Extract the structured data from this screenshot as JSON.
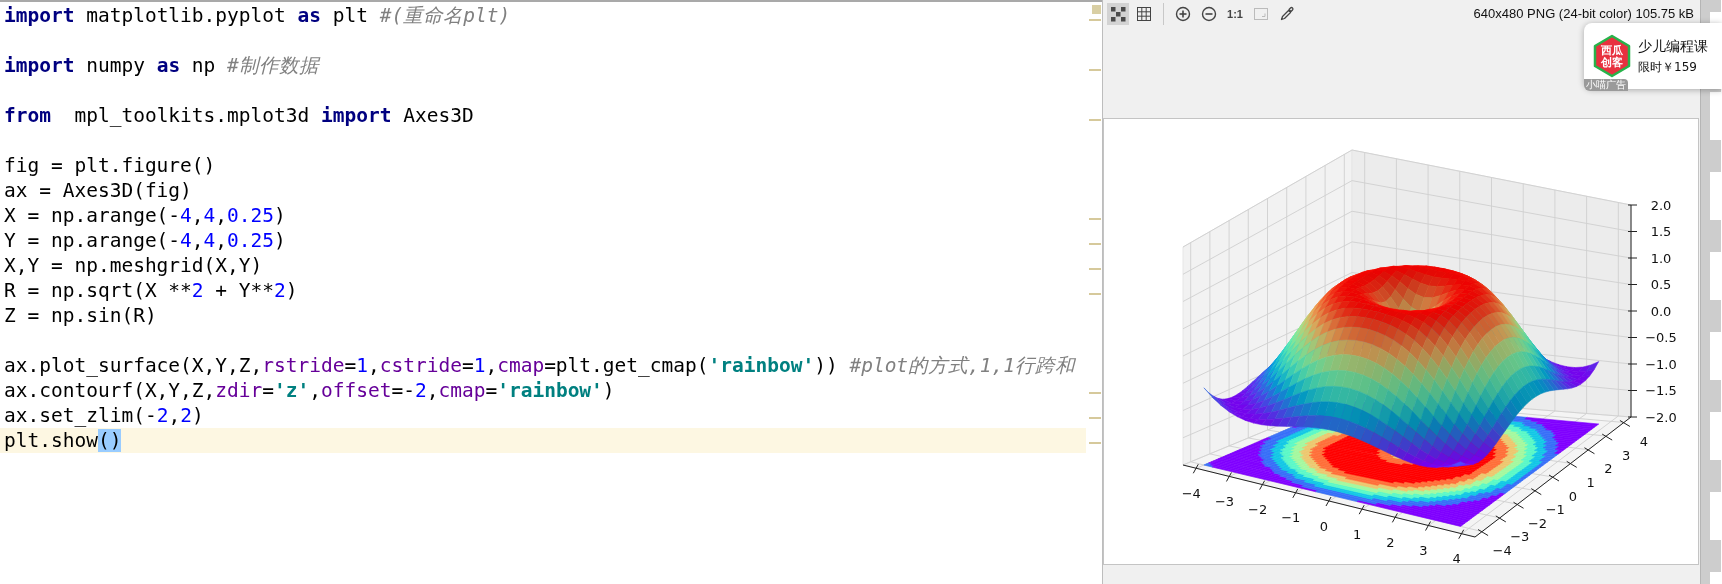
{
  "editor": {
    "lines": [
      {
        "kind": "code",
        "current": false,
        "tokens": [
          {
            "kind": "keyword",
            "text": "import"
          },
          {
            "kind": "plain",
            "text": " matplotlib.pyplot "
          },
          {
            "kind": "keyword",
            "text": "as"
          },
          {
            "kind": "plain",
            "text": " plt "
          },
          {
            "kind": "comment",
            "text": "#(重命名plt)"
          }
        ]
      },
      {
        "kind": "blank"
      },
      {
        "kind": "code",
        "current": false,
        "tokens": [
          {
            "kind": "keyword",
            "text": "import"
          },
          {
            "kind": "plain",
            "text": " numpy "
          },
          {
            "kind": "keyword",
            "text": "as"
          },
          {
            "kind": "plain",
            "text": " np "
          },
          {
            "kind": "comment",
            "text": "#制作数据"
          }
        ]
      },
      {
        "kind": "blank"
      },
      {
        "kind": "code",
        "current": false,
        "tokens": [
          {
            "kind": "keyword",
            "text": "from"
          },
          {
            "kind": "plain",
            "text": "  mpl_toolkits.mplot3d "
          },
          {
            "kind": "keyword",
            "text": "import"
          },
          {
            "kind": "plain",
            "text": " Axes3D"
          }
        ]
      },
      {
        "kind": "blank"
      },
      {
        "kind": "code",
        "current": false,
        "tokens": [
          {
            "kind": "plain",
            "text": "fig = plt.figure()"
          }
        ]
      },
      {
        "kind": "code",
        "current": false,
        "tokens": [
          {
            "kind": "plain",
            "text": "ax = Axes3D(fig)"
          }
        ]
      },
      {
        "kind": "code",
        "current": false,
        "tokens": [
          {
            "kind": "plain",
            "text": "X = np.arange(-"
          },
          {
            "kind": "number",
            "text": "4"
          },
          {
            "kind": "plain",
            "text": ","
          },
          {
            "kind": "number",
            "text": "4"
          },
          {
            "kind": "plain",
            "text": ","
          },
          {
            "kind": "number",
            "text": "0.25"
          },
          {
            "kind": "plain",
            "text": ")"
          }
        ]
      },
      {
        "kind": "code",
        "current": false,
        "tokens": [
          {
            "kind": "plain",
            "text": "Y = np.arange(-"
          },
          {
            "kind": "number",
            "text": "4"
          },
          {
            "kind": "plain",
            "text": ","
          },
          {
            "kind": "number",
            "text": "4"
          },
          {
            "kind": "plain",
            "text": ","
          },
          {
            "kind": "number",
            "text": "0.25"
          },
          {
            "kind": "plain",
            "text": ")"
          }
        ]
      },
      {
        "kind": "code",
        "current": false,
        "tokens": [
          {
            "kind": "plain",
            "text": "X,Y = np.meshgrid(X,Y)"
          }
        ]
      },
      {
        "kind": "code",
        "current": false,
        "tokens": [
          {
            "kind": "plain",
            "text": "R = np.sqrt(X **"
          },
          {
            "kind": "number",
            "text": "2"
          },
          {
            "kind": "plain",
            "text": " + Y**"
          },
          {
            "kind": "number",
            "text": "2"
          },
          {
            "kind": "plain",
            "text": ")"
          }
        ]
      },
      {
        "kind": "code",
        "current": false,
        "tokens": [
          {
            "kind": "plain",
            "text": "Z = np.sin(R)"
          }
        ]
      },
      {
        "kind": "blank"
      },
      {
        "kind": "code",
        "current": false,
        "tokens": [
          {
            "kind": "plain",
            "text": "ax.plot_surface(X,Y,Z,"
          },
          {
            "kind": "param",
            "text": "rstride"
          },
          {
            "kind": "plain",
            "text": "="
          },
          {
            "kind": "number",
            "text": "1"
          },
          {
            "kind": "plain",
            "text": ","
          },
          {
            "kind": "param",
            "text": "cstride"
          },
          {
            "kind": "plain",
            "text": "="
          },
          {
            "kind": "number",
            "text": "1"
          },
          {
            "kind": "plain",
            "text": ","
          },
          {
            "kind": "param",
            "text": "cmap"
          },
          {
            "kind": "plain",
            "text": "=plt.get_cmap("
          },
          {
            "kind": "string",
            "text": "'rainbow'"
          },
          {
            "kind": "plain",
            "text": ")) "
          },
          {
            "kind": "comment",
            "text": "#plot的方式,1,1行跨和"
          }
        ]
      },
      {
        "kind": "code",
        "current": false,
        "tokens": [
          {
            "kind": "plain",
            "text": "ax.contourf(X,Y,Z,"
          },
          {
            "kind": "param",
            "text": "zdir"
          },
          {
            "kind": "plain",
            "text": "="
          },
          {
            "kind": "string",
            "text": "'z'"
          },
          {
            "kind": "plain",
            "text": ","
          },
          {
            "kind": "param",
            "text": "offset"
          },
          {
            "kind": "plain",
            "text": "=-"
          },
          {
            "kind": "number",
            "text": "2"
          },
          {
            "kind": "plain",
            "text": ","
          },
          {
            "kind": "param",
            "text": "cmap"
          },
          {
            "kind": "plain",
            "text": "="
          },
          {
            "kind": "string",
            "text": "'rainbow'"
          },
          {
            "kind": "plain",
            "text": ")"
          }
        ]
      },
      {
        "kind": "code",
        "current": false,
        "tokens": [
          {
            "kind": "plain",
            "text": "ax.set_zlim(-"
          },
          {
            "kind": "number",
            "text": "2"
          },
          {
            "kind": "plain",
            "text": ","
          },
          {
            "kind": "number",
            "text": "2"
          },
          {
            "kind": "plain",
            "text": ")"
          }
        ]
      },
      {
        "kind": "code",
        "current": true,
        "tokens": [
          {
            "kind": "plain",
            "text": "plt.show"
          },
          {
            "kind": "brace_match",
            "text": "()"
          }
        ]
      }
    ]
  },
  "viewer": {
    "toolbar": [
      {
        "kind": "checker",
        "selected": true,
        "disabled": false
      },
      {
        "kind": "grid",
        "selected": false,
        "disabled": false
      },
      {
        "kind": "separator"
      },
      {
        "kind": "zoom_in",
        "selected": false,
        "disabled": false
      },
      {
        "kind": "zoom_out",
        "selected": false,
        "disabled": false
      },
      {
        "kind": "actual_size",
        "label": "1:1",
        "selected": false,
        "disabled": false
      },
      {
        "kind": "fit",
        "selected": false,
        "disabled": true
      },
      {
        "kind": "eyedropper",
        "selected": false,
        "disabled": false
      }
    ],
    "image_info": "640x480 PNG (24-bit color) 105.75 kB",
    "plot": {
      "z_ticks": [
        "2.0",
        "1.5",
        "1.0",
        "0.5",
        "0.0",
        "−0.5",
        "−1.0",
        "−1.5",
        "−2.0"
      ],
      "x_ticks": [
        "−4",
        "−3",
        "−2",
        "−1",
        "0",
        "1",
        "2",
        "3",
        "4"
      ],
      "y_ticks": [
        "−4",
        "−3",
        "−2",
        "−1",
        "0",
        "1",
        "2",
        "3",
        "4"
      ]
    }
  },
  "ad": {
    "logo_text": [
      "西瓜",
      "创客"
    ],
    "title": "少儿编程课",
    "price": "限时￥159",
    "tag": "小喵广告"
  }
}
